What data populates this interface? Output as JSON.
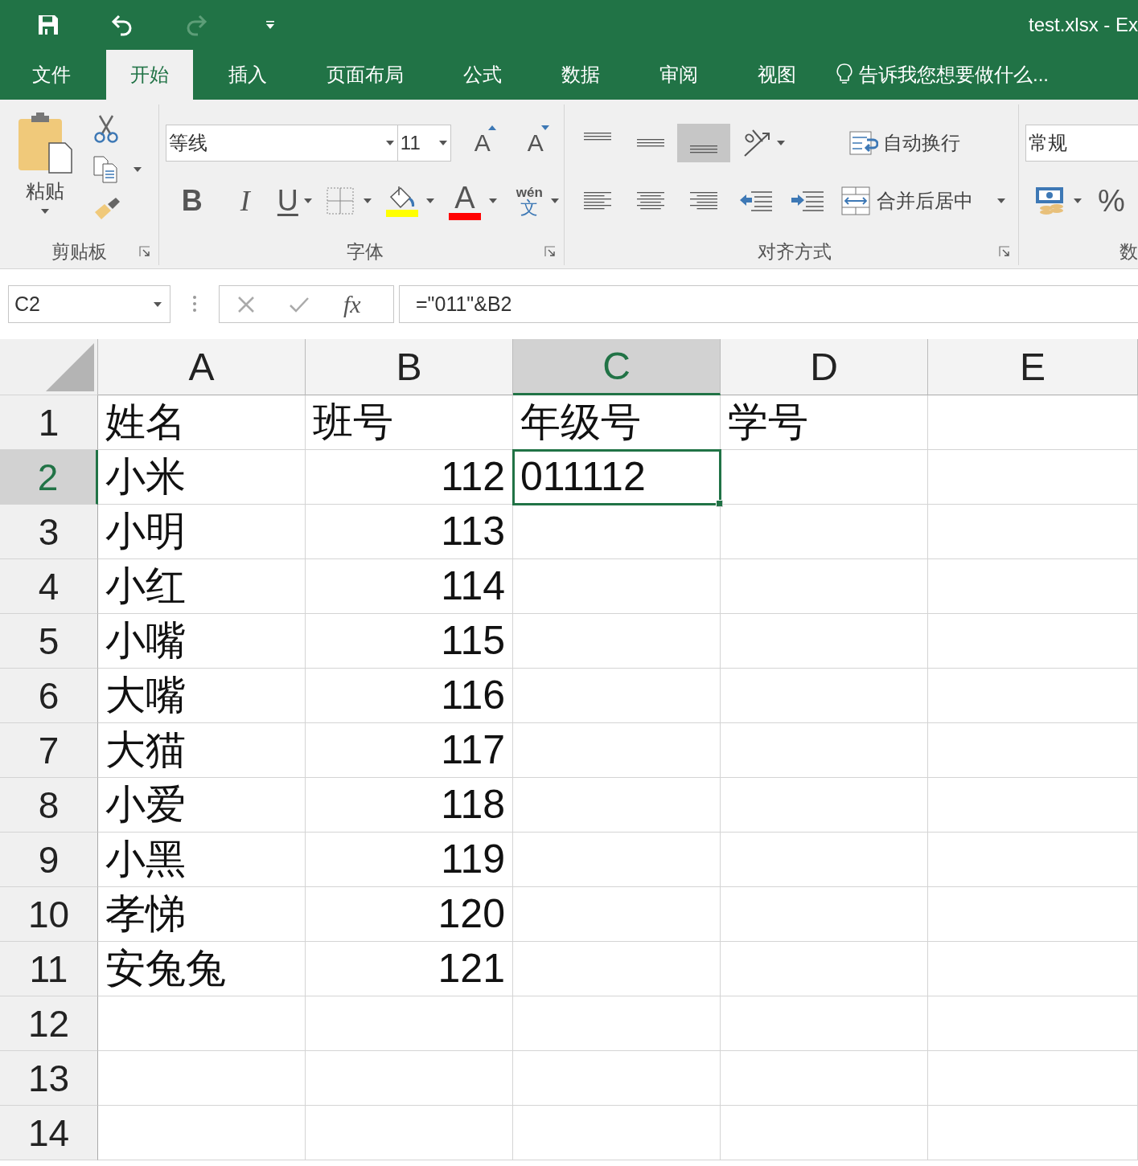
{
  "title_bar": {
    "quick_access": [
      {
        "kind": "save",
        "disabled": false
      },
      {
        "kind": "undo",
        "disabled": false
      },
      {
        "kind": "redo",
        "disabled": true
      },
      {
        "kind": "customize",
        "disabled": false
      }
    ],
    "title": "test.xlsx - Ex"
  },
  "tabs": [
    {
      "label": "文件",
      "selected": false
    },
    {
      "label": "开始",
      "selected": true
    },
    {
      "label": "插入",
      "selected": false
    },
    {
      "label": "页面布局",
      "selected": false
    },
    {
      "label": "公式",
      "selected": false
    },
    {
      "label": "数据",
      "selected": false
    },
    {
      "label": "审阅",
      "selected": false
    },
    {
      "label": "视图",
      "selected": false
    }
  ],
  "tell_me": "告诉我您想要做什么...",
  "ribbon": {
    "clipboard": {
      "label": "剪贴板",
      "paste": "粘贴"
    },
    "font": {
      "label": "字体",
      "font_name": "等线",
      "font_size": "11",
      "grow": "A",
      "shrink": "A",
      "styles": [
        {
          "kind": "bold",
          "label": "B"
        },
        {
          "kind": "italic",
          "label": "I"
        },
        {
          "kind": "underline",
          "label": "U"
        }
      ],
      "fill_color": {
        "color": "#ffff00"
      },
      "font_color": {
        "label": "A",
        "color": "#ff0000"
      },
      "phonetic": {
        "top": "wén",
        "bottom": "文"
      }
    },
    "alignment": {
      "label": "对齐方式",
      "vertical": [
        {
          "kind": "top",
          "selected": false
        },
        {
          "kind": "middle",
          "selected": false
        },
        {
          "kind": "bottom",
          "selected": true
        }
      ],
      "horizontal": [
        {
          "kind": "left",
          "selected": false
        },
        {
          "kind": "center",
          "selected": false
        },
        {
          "kind": "right",
          "selected": false
        }
      ],
      "wrap_text": "自动换行",
      "merge": "合并后居中"
    },
    "number": {
      "label": "数",
      "format": "常规",
      "percent": "%"
    }
  },
  "formula_bar": {
    "name_box": "C2",
    "fx": "fx",
    "formula": "=\"011\"&B2"
  },
  "grid": {
    "columns": [
      {
        "label": "A",
        "selected": false
      },
      {
        "label": "B",
        "selected": false
      },
      {
        "label": "C",
        "selected": true
      },
      {
        "label": "D",
        "selected": false
      },
      {
        "label": "E",
        "selected": false
      }
    ],
    "rows": [
      {
        "label": "1",
        "selected": false,
        "cells": [
          {
            "value": "姓名",
            "kind": "text"
          },
          {
            "value": "班号",
            "kind": "text"
          },
          {
            "value": "年级号",
            "kind": "text"
          },
          {
            "value": "学号",
            "kind": "text"
          },
          null
        ]
      },
      {
        "label": "2",
        "selected": true,
        "cells": [
          {
            "value": "小米",
            "kind": "text"
          },
          {
            "value": "112",
            "kind": "number"
          },
          {
            "value": "011112",
            "kind": "text"
          },
          null,
          null
        ]
      },
      {
        "label": "3",
        "selected": false,
        "cells": [
          {
            "value": "小明",
            "kind": "text"
          },
          {
            "value": "113",
            "kind": "number"
          },
          null,
          null,
          null
        ]
      },
      {
        "label": "4",
        "selected": false,
        "cells": [
          {
            "value": "小红",
            "kind": "text"
          },
          {
            "value": "114",
            "kind": "number"
          },
          null,
          null,
          null
        ]
      },
      {
        "label": "5",
        "selected": false,
        "cells": [
          {
            "value": "小嘴",
            "kind": "text"
          },
          {
            "value": "115",
            "kind": "number"
          },
          null,
          null,
          null
        ]
      },
      {
        "label": "6",
        "selected": false,
        "cells": [
          {
            "value": "大嘴",
            "kind": "text"
          },
          {
            "value": "116",
            "kind": "number"
          },
          null,
          null,
          null
        ]
      },
      {
        "label": "7",
        "selected": false,
        "cells": [
          {
            "value": "大猫",
            "kind": "text"
          },
          {
            "value": "117",
            "kind": "number"
          },
          null,
          null,
          null
        ]
      },
      {
        "label": "8",
        "selected": false,
        "cells": [
          {
            "value": "小爱",
            "kind": "text"
          },
          {
            "value": "118",
            "kind": "number"
          },
          null,
          null,
          null
        ]
      },
      {
        "label": "9",
        "selected": false,
        "cells": [
          {
            "value": "小黑",
            "kind": "text"
          },
          {
            "value": "119",
            "kind": "number"
          },
          null,
          null,
          null
        ]
      },
      {
        "label": "10",
        "selected": false,
        "cells": [
          {
            "value": "孝悌",
            "kind": "text"
          },
          {
            "value": "120",
            "kind": "number"
          },
          null,
          null,
          null
        ]
      },
      {
        "label": "11",
        "selected": false,
        "cells": [
          {
            "value": "安兔兔",
            "kind": "text"
          },
          {
            "value": "121",
            "kind": "number"
          },
          null,
          null,
          null
        ]
      },
      {
        "label": "12",
        "selected": false,
        "cells": [
          null,
          null,
          null,
          null,
          null
        ]
      },
      {
        "label": "13",
        "selected": false,
        "cells": [
          null,
          null,
          null,
          null,
          null
        ]
      },
      {
        "label": "14",
        "selected": false,
        "cells": [
          null,
          null,
          null,
          null,
          null
        ]
      }
    ]
  }
}
